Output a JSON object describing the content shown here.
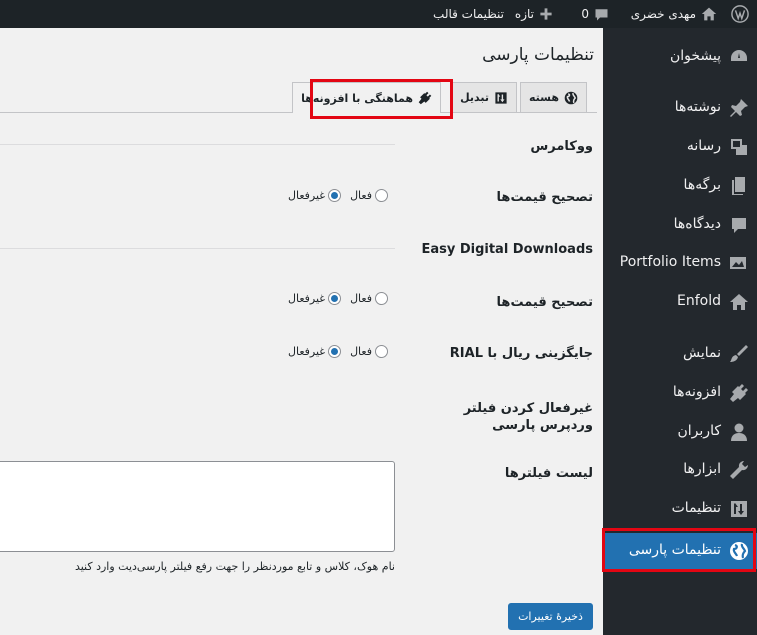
{
  "adminbar": {
    "site_name": "مهدی خضری",
    "comments_count": "0",
    "new_label": "تازه",
    "theme_settings": "تنظیمات قالب"
  },
  "sidebar": {
    "items": [
      {
        "label": "پیشخوان",
        "icon": "dashboard-icon"
      },
      {
        "label": "نوشته‌ها",
        "icon": "pin-icon"
      },
      {
        "label": "رسانه",
        "icon": "media-icon"
      },
      {
        "label": "برگه‌ها",
        "icon": "pages-icon"
      },
      {
        "label": "دیدگاه‌ها",
        "icon": "comments-icon"
      },
      {
        "label": "Portfolio Items",
        "icon": "portfolio-icon"
      },
      {
        "label": "Enfold",
        "icon": "home-icon"
      },
      {
        "label": "نمایش",
        "icon": "brush-icon"
      },
      {
        "label": "افزونه‌ها",
        "icon": "plugins-icon"
      },
      {
        "label": "کاربران",
        "icon": "users-icon"
      },
      {
        "label": "ابزارها",
        "icon": "tools-icon"
      },
      {
        "label": "تنظیمات",
        "icon": "settings-icon"
      },
      {
        "label": "تنظیمات پارسی",
        "icon": "globe-icon",
        "current": true
      }
    ]
  },
  "page": {
    "title": "تنظیمات پارسی",
    "tabs": [
      {
        "label": "هسته",
        "icon": "globe-icon"
      },
      {
        "label": "تبدیل",
        "icon": "sort-icon"
      },
      {
        "label": "هماهنگی با افزونه‌ها",
        "icon": "plugin-icon",
        "active": true
      }
    ]
  },
  "sections": {
    "woocommerce": {
      "title": "ووکامرس",
      "price_fix_label": "تصحیح قیمت‌ها",
      "active": "فعال",
      "inactive": "غیرفعال"
    },
    "edd": {
      "title": "Easy Digital Downloads",
      "price_fix_label": "تصحیح قیمت‌ها",
      "rial_label": "جایگزینی ریال با RIAL",
      "active": "فعال",
      "inactive": "غیرفعال"
    },
    "filters": {
      "disable_label": "غیرفعال کردن فیلتر وردپرس پارسی",
      "list_label": "لیست فیلترها",
      "description": "نام هوک، کلاس و تابع موردنظر را جهت رفع فیلتر پارسی‌دیت وارد کنید"
    }
  },
  "save_button": "ذخیرهٔ تغییرات",
  "colors": {
    "adminbar_bg": "#1d2327",
    "sidebar_bg": "#23282d",
    "accent": "#2271b1",
    "highlight": "#e30613"
  }
}
